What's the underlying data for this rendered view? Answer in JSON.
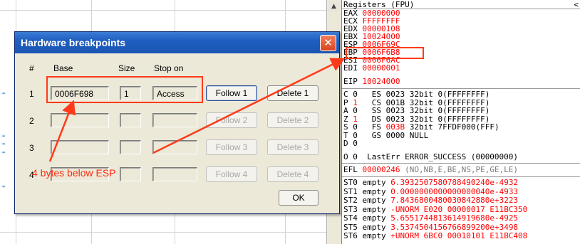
{
  "dialog": {
    "title": "Hardware breakpoints",
    "close_glyph": "✕",
    "headers": {
      "num": "#",
      "base": "Base",
      "size": "Size",
      "stop_on": "Stop on"
    },
    "rows": [
      {
        "num": "1",
        "base": "0006F698",
        "size": "1",
        "stop_on": "Access",
        "follow": "Follow 1",
        "delete": "Delete 1",
        "enabled": true
      },
      {
        "num": "2",
        "base": "",
        "size": "",
        "stop_on": "",
        "follow": "Follow 2",
        "delete": "Delete 2",
        "enabled": false
      },
      {
        "num": "3",
        "base": "",
        "size": "",
        "stop_on": "",
        "follow": "Follow 3",
        "delete": "Delete 3",
        "enabled": false
      },
      {
        "num": "4",
        "base": "",
        "size": "",
        "stop_on": "",
        "follow": "Follow 4",
        "delete": "Delete 4",
        "enabled": false
      }
    ],
    "ok_label": "OK"
  },
  "annotation": {
    "text": "4 bytes below ESP",
    "color": "#ff2a10"
  },
  "registers": {
    "title": "Registers (FPU)",
    "close_glyph": "<",
    "gp": [
      {
        "name": "EAX",
        "value": "00000000"
      },
      {
        "name": "ECX",
        "value": "FFFFFFFF"
      },
      {
        "name": "EDX",
        "value": "00000108"
      },
      {
        "name": "EBX",
        "value": "10024000"
      },
      {
        "name": "ESP",
        "value": "0006F69C"
      },
      {
        "name": "EBP",
        "value": "0006F6B8"
      },
      {
        "name": "ESI",
        "value": "0006F6AC"
      },
      {
        "name": "EDI",
        "value": "00000001"
      }
    ],
    "eip": {
      "name": "EIP",
      "value": "10024000"
    },
    "flags": [
      {
        "flag": "C",
        "val": "0",
        "seg": "ES",
        "sel": "0023",
        "bits": "32bit",
        "base": "0(FFFFFFFF)",
        "val_red": false,
        "sel_red": false
      },
      {
        "flag": "P",
        "val": "1",
        "seg": "CS",
        "sel": "001B",
        "bits": "32bit",
        "base": "0(FFFFFFFF)",
        "val_red": true,
        "sel_red": false
      },
      {
        "flag": "A",
        "val": "0",
        "seg": "SS",
        "sel": "0023",
        "bits": "32bit",
        "base": "0(FFFFFFFF)",
        "val_red": false,
        "sel_red": false
      },
      {
        "flag": "Z",
        "val": "1",
        "seg": "DS",
        "sel": "0023",
        "bits": "32bit",
        "base": "0(FFFFFFFF)",
        "val_red": true,
        "sel_red": false
      },
      {
        "flag": "S",
        "val": "0",
        "seg": "FS",
        "sel": "003B",
        "bits": "32bit",
        "base": "7FFDF000(FFF)",
        "val_red": false,
        "sel_red": true
      },
      {
        "flag": "T",
        "val": "0",
        "seg": "GS",
        "sel": "0000",
        "bits": "NULL",
        "base": "",
        "val_red": false,
        "sel_red": false
      },
      {
        "flag": "D",
        "val": "0",
        "seg": "",
        "sel": "",
        "bits": "",
        "base": "",
        "val_red": false,
        "sel_red": false
      }
    ],
    "lasterr": {
      "flag": "O",
      "val": "0",
      "text": "LastErr ERROR_SUCCESS (00000000)"
    },
    "efl": {
      "name": "EFL",
      "value": "00000246",
      "detail": "(NO,NB,E,BE,NS,PE,GE,LE)"
    },
    "fpu": [
      {
        "name": "ST0",
        "state": "empty",
        "value": "6.3932507580788490240e-4932"
      },
      {
        "name": "ST1",
        "state": "empty",
        "value": "0.0000000000000000040e-4933"
      },
      {
        "name": "ST2",
        "state": "empty",
        "value": "7.8436800480030842880e+3223"
      },
      {
        "name": "ST3",
        "state": "empty",
        "value": "-UNORM E020 00000017 E11BC350"
      },
      {
        "name": "ST4",
        "state": "empty",
        "value": "5.6551744813614919680e-4925"
      },
      {
        "name": "ST5",
        "state": "empty",
        "value": "3.5374504156766899200e+3498"
      },
      {
        "name": "ST6",
        "state": "empty",
        "value": "+UNORM 6BC0 00010101 E11BC408"
      }
    ]
  },
  "colors": {
    "accent_red": "#ff0000",
    "title_blue": "#1f5fc0",
    "dialog_bg": "#ece9d8"
  }
}
